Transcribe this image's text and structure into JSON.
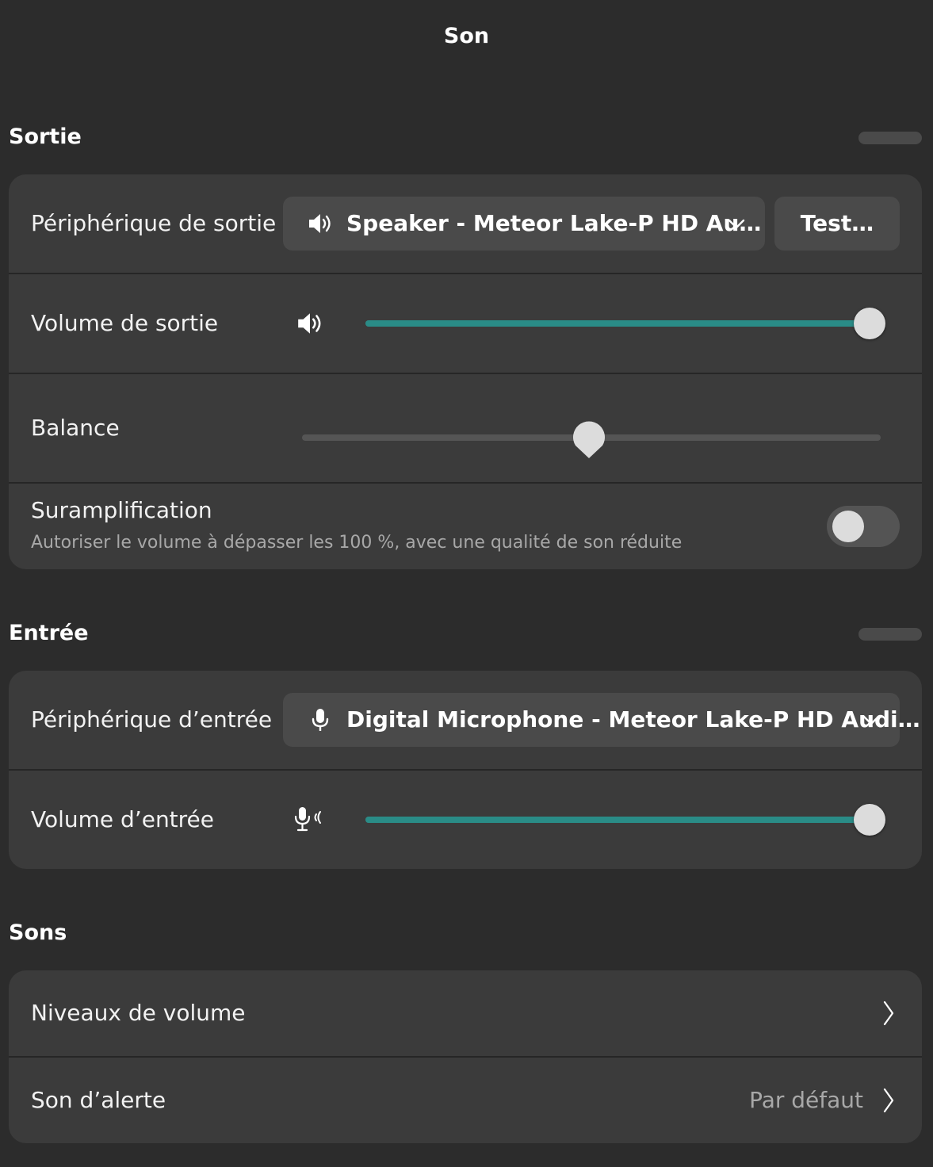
{
  "window": {
    "title": "Son"
  },
  "output": {
    "heading": "Sortie",
    "device_label": "Périphérique de sortie",
    "device_value": "Speaker - Meteor Lake-P HD Au…",
    "test_button": "Test…",
    "volume_label": "Volume de sortie",
    "volume_level": 1.0,
    "balance_label": "Balance",
    "balance_level": 0.5,
    "overamp_label": "Suramplification",
    "overamp_desc": "Autoriser le volume à dépasser les 100 %, avec une qualité de son réduite",
    "overamp_enabled": false
  },
  "input": {
    "heading": "Entrée",
    "device_label": "Périphérique d’entrée",
    "device_value": "Digital Microphone - Meteor Lake-P HD Audi…",
    "volume_label": "Volume d’entrée",
    "volume_level": 1.0
  },
  "sounds": {
    "heading": "Sons",
    "volume_levels_label": "Niveaux de volume",
    "alert_label": "Son d’alerte",
    "alert_value": "Par défaut"
  },
  "colors": {
    "accent": "#2a8c87",
    "background": "#2c2c2c",
    "card": "#3b3b3b",
    "control": "#4a4a4a"
  },
  "icons": {
    "speaker": "speaker-icon",
    "microphone": "microphone-icon",
    "mic_sensitivity": "microphone-sensitivity-icon",
    "chevron_down": "chevron-down-icon",
    "chevron_right": "chevron-right-icon"
  }
}
